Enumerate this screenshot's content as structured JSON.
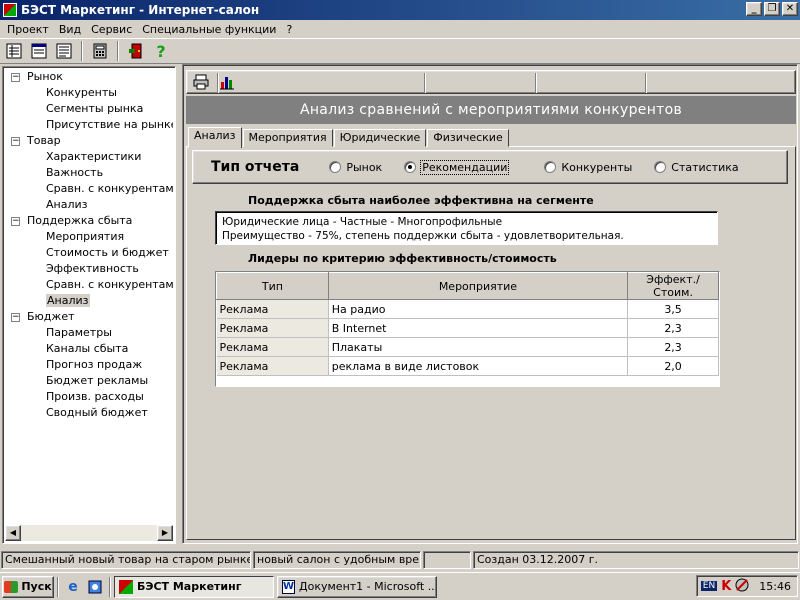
{
  "window": {
    "title": "БЭСТ Маркетинг - Интернет-салон"
  },
  "menu": [
    "Проект",
    "Вид",
    "Сервис",
    "Специальные функции",
    "?"
  ],
  "toolbar": {
    "icons": [
      "list-view-icon",
      "table-view-icon",
      "report-view-icon",
      "calculator-icon",
      "exit-door-icon",
      "help-icon"
    ],
    "help_label": "?"
  },
  "tree": [
    {
      "label": "Рынок",
      "level": 0,
      "expander": "−"
    },
    {
      "label": "Конкуренты",
      "level": 1
    },
    {
      "label": "Сегменты рынка",
      "level": 1
    },
    {
      "label": "Присутствие на рынке",
      "level": 1
    },
    {
      "label": "Товар",
      "level": 0,
      "expander": "−"
    },
    {
      "label": "Характеристики",
      "level": 1
    },
    {
      "label": "Важность",
      "level": 1
    },
    {
      "label": "Сравн. с конкурентами",
      "level": 1
    },
    {
      "label": "Анализ",
      "level": 1
    },
    {
      "label": "Поддержка сбыта",
      "level": 0,
      "expander": "−"
    },
    {
      "label": "Мероприятия",
      "level": 1
    },
    {
      "label": "Стоимость и бюджет",
      "level": 1
    },
    {
      "label": "Эффективность",
      "level": 1
    },
    {
      "label": "Сравн. с конкурентами",
      "level": 1
    },
    {
      "label": "Анализ",
      "level": 1,
      "selected": true
    },
    {
      "label": "Бюджет",
      "level": 0,
      "expander": "−"
    },
    {
      "label": "Параметры",
      "level": 1
    },
    {
      "label": "Каналы сбыта",
      "level": 1
    },
    {
      "label": "Прогноз продаж",
      "level": 1
    },
    {
      "label": "Бюджет рекламы",
      "level": 1
    },
    {
      "label": "Произв. расходы",
      "level": 1
    },
    {
      "label": "Сводный бюджет",
      "level": 1
    }
  ],
  "panel": {
    "header": "Анализ сравнений с мероприятиями конкурентов",
    "tabs": [
      "Анализ",
      "Мероприятия",
      "Юридические",
      "Физические"
    ],
    "active_tab": 0,
    "report_type": {
      "label": "Тип отчета",
      "options": [
        "Рынок",
        "Рекомендации",
        "Конкуренты",
        "Статистика"
      ],
      "selected": 1
    },
    "support": {
      "title": "Поддержка сбыта наиболее эффективна на сегменте",
      "line1": "Юридические лица - Частные - Многопрофильные",
      "line2": "Преимущество - 75%,  степень поддержки сбыта - удовлетворительная."
    },
    "leaders": {
      "title": "Лидеры по критерию эффективность/стоимость",
      "columns": [
        "Тип",
        "Мероприятие",
        "Эффект./Стоим."
      ],
      "rows": [
        [
          "Реклама",
          "На радио",
          "3,5"
        ],
        [
          "Реклама",
          "В Internet",
          "2,3"
        ],
        [
          "Реклама",
          "Плакаты",
          "2,3"
        ],
        [
          "Реклама",
          "реклама в виде листовок",
          "2,0"
        ]
      ]
    }
  },
  "statusbar": [
    "Смешанный новый товар на старом рынке",
    "новый салон с удобным вре...",
    "",
    "Создан 03.12.2007 г."
  ],
  "taskbar": {
    "start": "Пуск",
    "tasks": [
      "БЭСТ Маркетинг",
      "Документ1 - Microsoft ..."
    ],
    "lang": "EN",
    "clock": "15:46"
  }
}
